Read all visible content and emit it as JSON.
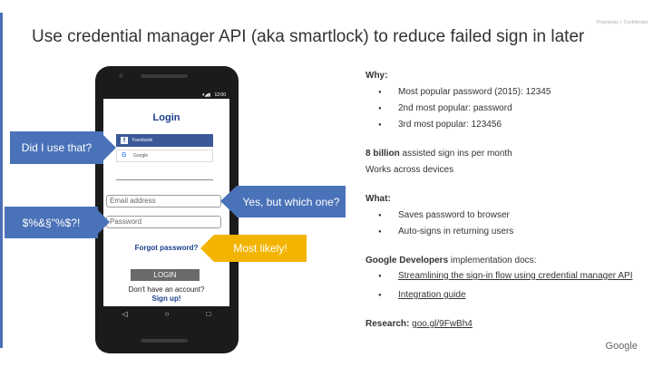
{
  "slide": {
    "title": "Use credential manager API (aka smartlock) to reduce failed sign in later",
    "confidential": "Proprietary + Confidential",
    "footer_logo": "Google"
  },
  "phone": {
    "status_time": "12:00",
    "status_icons": "▾◢▮",
    "login_title": "Login",
    "facebook_label": "Facebook",
    "google_label": "Google",
    "email_placeholder": "Email address",
    "password_placeholder": "Password",
    "forgot_label": "Forgot password?",
    "login_button": "LOGIN",
    "no_account": "Don't have an account?",
    "signup": "Sign up!",
    "nav": [
      "◁",
      "○",
      "□"
    ]
  },
  "callouts": {
    "did_i_use": "Did I use that?",
    "which_one": "Yes, but which one?",
    "garbled": "$%&§\"%$?!",
    "most_likely": "Most likely!"
  },
  "notes": {
    "why_label": "Why:",
    "why_items": [
      "Most popular password (2015): 12345",
      "2nd most popular: password",
      "3rd most popular: 123456"
    ],
    "billion_bold": "8 billion",
    "billion_rest": " assisted sign ins per month",
    "works": "Works across devices",
    "what_label": "What:",
    "what_items": [
      "Saves password to browser",
      "Auto-signs in returning users"
    ],
    "docs_bold": "Google Developers",
    "docs_rest": " implementation docs:",
    "doc_links": [
      "Streamlining the sign-in flow using credential manager API",
      "Integration guide"
    ],
    "research_label": "Research:",
    "research_link": "goo.gl/9FwBh4"
  },
  "colors": {
    "callout_blue": "#4a72b8",
    "callout_yellow": "#f3b400",
    "login_navy": "#1a3d8c",
    "facebook_blue": "#3b5998"
  }
}
